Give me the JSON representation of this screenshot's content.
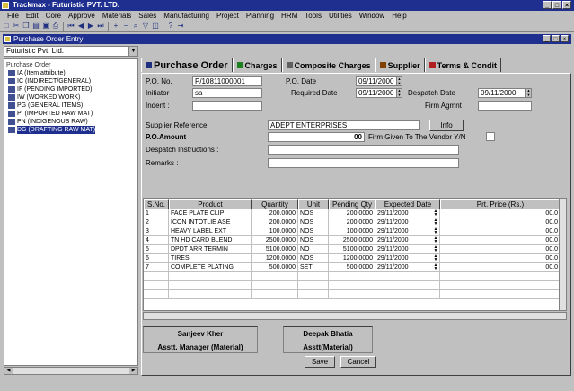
{
  "window": {
    "title": "Trackmax - Futuristic PVT. LTD."
  },
  "menu": [
    "File",
    "Edit",
    "Core",
    "Approve",
    "Materials",
    "Sales",
    "Manufacturing",
    "Project",
    "Planning",
    "HRM",
    "Tools",
    "Utilities",
    "Window",
    "Help"
  ],
  "toolbar_icons": [
    "new-icon",
    "cut-icon",
    "copy-icon",
    "paste-icon",
    "save-icon",
    "print-icon",
    "first-icon",
    "prev-icon",
    "next-icon",
    "last-icon",
    "add-icon",
    "delete-icon",
    "find-icon",
    "filter-icon",
    "view-icon",
    "help-icon",
    "exit-icon"
  ],
  "inner_window": {
    "title": "Purchase Order Entry"
  },
  "company": {
    "selected": "Futuristic Pvt. Ltd."
  },
  "tree": {
    "root": "Purchase Order",
    "items": [
      "IA (Item attribute)",
      "IC (INDIRECT/GENERAL)",
      "IF (PENDING IMPORTED)",
      "IW (WORKED WORK)",
      "PG (GENERAL ITEMS)",
      "PI (IMPORTED RAW MAT)",
      "PN (INDIGENOUS RAW)",
      "DG (DRAFTING RAW MAT)"
    ],
    "selected_index": 7
  },
  "tabs": [
    {
      "label": "Purchase Order",
      "icon": "po-icon",
      "active": true
    },
    {
      "label": "Charges",
      "icon": "charges-icon",
      "active": false
    },
    {
      "label": "Composite Charges",
      "icon": "composite-icon",
      "active": false
    },
    {
      "label": "Supplier",
      "icon": "supplier-icon",
      "active": false
    },
    {
      "label": "Terms & Condit",
      "icon": "terms-icon",
      "active": false
    }
  ],
  "form": {
    "po_no_label": "P.O. No.",
    "po_no": "P/10811000001",
    "po_date_label": "P.O. Date",
    "po_date": "09/11/2000",
    "initiator_label": "Initiator :",
    "initiator": "sa",
    "required_date_label": "Required Date",
    "required_date": "09/11/2000",
    "despatch_date_label": "Despatch Date",
    "despatch_date": "09/11/2000",
    "indent_label": "Indent :",
    "indent": "",
    "firm_agmt_label": "Firm Agmnt",
    "firm_agmt": "",
    "supplier_ref_label": "Supplier Reference",
    "supplier_ref": "ADEPT ENTERPRISES",
    "info_button": "Info",
    "po_amount_label": "P.O.Amount",
    "po_amount": "00",
    "firm_given_label": "Firm Given To The Vendor Y/N",
    "despatch_instr_label": "Despatch Instructions :",
    "despatch_instr": "",
    "remarks_label": "Remarks :",
    "remarks": ""
  },
  "grid": {
    "columns": [
      "S.No.",
      "Product",
      "Quantity",
      "Unit",
      "Pending Qty",
      "Expected Date",
      "Prt. Price (Rs.)"
    ],
    "rows": [
      [
        "1",
        "FACE PLATE CLIP",
        "200.0000",
        "NOS",
        "200.0000",
        "29/11/2000",
        "00.0"
      ],
      [
        "2",
        "ICON INTOTLIE ASE",
        "200.0000",
        "NOS",
        "200.0000",
        "29/11/2000",
        "00.0"
      ],
      [
        "3",
        "HEAVY LABEL EXT",
        "100.0000",
        "NOS",
        "100.0000",
        "29/11/2000",
        "00.0"
      ],
      [
        "4",
        "TN HD CARD BLEND",
        "2500.0000",
        "NOS",
        "2500.0000",
        "29/11/2000",
        "00.0"
      ],
      [
        "5",
        "DPDT ARR TERMIN",
        "5100.0000",
        "NO",
        "5100.0000",
        "29/11/2000",
        "00.0"
      ],
      [
        "6",
        "TIRES",
        "1200.0000",
        "NOS",
        "1200.0000",
        "29/11/2000",
        "00.0"
      ],
      [
        "7",
        "COMPLETE PLATING",
        "500.0000",
        "SET",
        "500.0000",
        "29/11/2000",
        "00.0"
      ]
    ]
  },
  "signatories": [
    {
      "name": "Sanjeev Kher",
      "role": "Asstt. Manager (Material)"
    },
    {
      "name": "Deepak Bhatia",
      "role": "Asstt(Material)"
    }
  ],
  "buttons": {
    "save": "Save",
    "cancel": "Cancel"
  }
}
